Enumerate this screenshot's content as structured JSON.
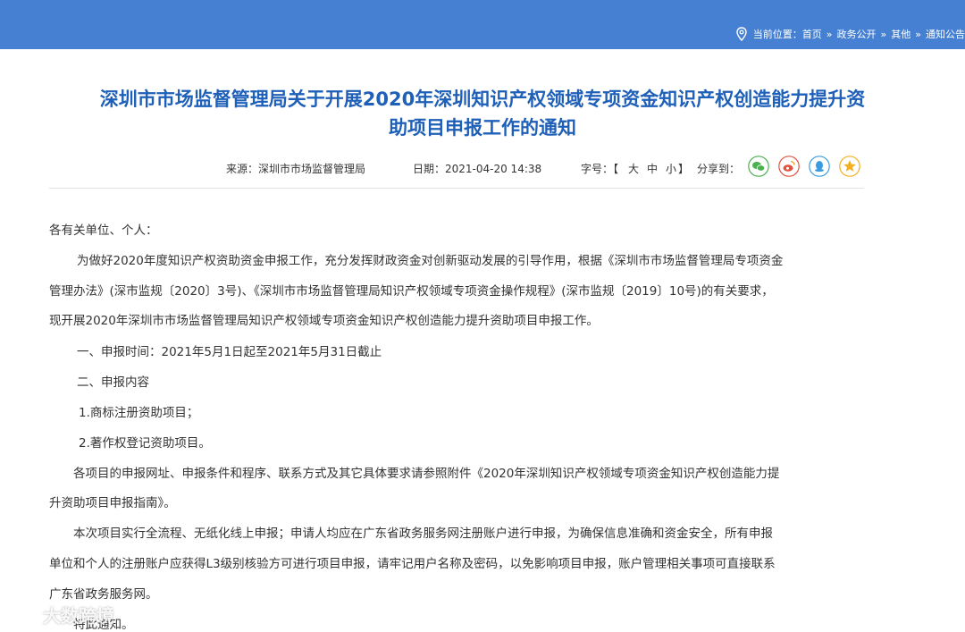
{
  "breadcrumb": {
    "label": "当前位置：",
    "items": [
      "首页",
      "政务公开",
      "其他",
      "通知公告"
    ],
    "separator": "»"
  },
  "article": {
    "title_line1": "深圳市市场监督管理局关于开展2020年深圳知识产权领域专项资金知识产权创造能力提升资",
    "title_line2": "助项目申报工作的通知",
    "source": "来源：深圳市市场监督管理局",
    "date": "日期：2021-04-20 14:38",
    "font_size_label": "字号：【",
    "font_large": "大",
    "font_medium": "中",
    "font_small": "小",
    "font_size_close": "】",
    "share_label": "分享到：",
    "share_icons": [
      "wechat-icon",
      "weibo-icon",
      "qq-icon",
      "qzone-icon"
    ],
    "paragraphs": [
      "各有关单位、个人：",
      "为做好2020年度知识产权资助资金申报工作，充分发挥财政资金对创新驱动发展的引导作用，根据《深圳市市场监督管理局专项资金",
      "管理办法》(深市监规〔2020〕3号)、《深圳市市场监督管理局知识产权领域专项资金操作规程》(深市监规〔2019〕10号)的有关要求，",
      "现开展2020年深圳市市场监督管理局知识产权领域专项资金知识产权创造能力提升资助项目申报工作。",
      "一、申报时间：2021年5月1日起至2021年5月31日截止",
      "二、申报内容",
      "1.商标注册资助项目；",
      "2.著作权登记资助项目。",
      "各项目的申报网址、申报条件和程序、联系方式及其它具体要求请参照附件《2020年深圳知识产权领域专项资金知识产权创造能力提",
      "升资助项目申报指南》。",
      "本次项目实行全流程、无纸化线上申报；申请人均应在广东省政务服务网注册账户进行申报，为确保信息准确和资金安全，所有申报",
      "单位和个人的注册账户应获得L3级别核验方可进行项目申报，请牢记用户名称及密码，以免影响项目申报，账户管理相关事项可直接联系",
      "广东省政务服务网。",
      "特此通知。"
    ]
  },
  "watermark": "大数跨境",
  "colors": {
    "header": "#4680d2",
    "title": "#1e5fb8",
    "wechat": "#4caf50",
    "weibo": "#e0523f",
    "qq": "#3a9be0",
    "qzone": "#f2b020"
  }
}
